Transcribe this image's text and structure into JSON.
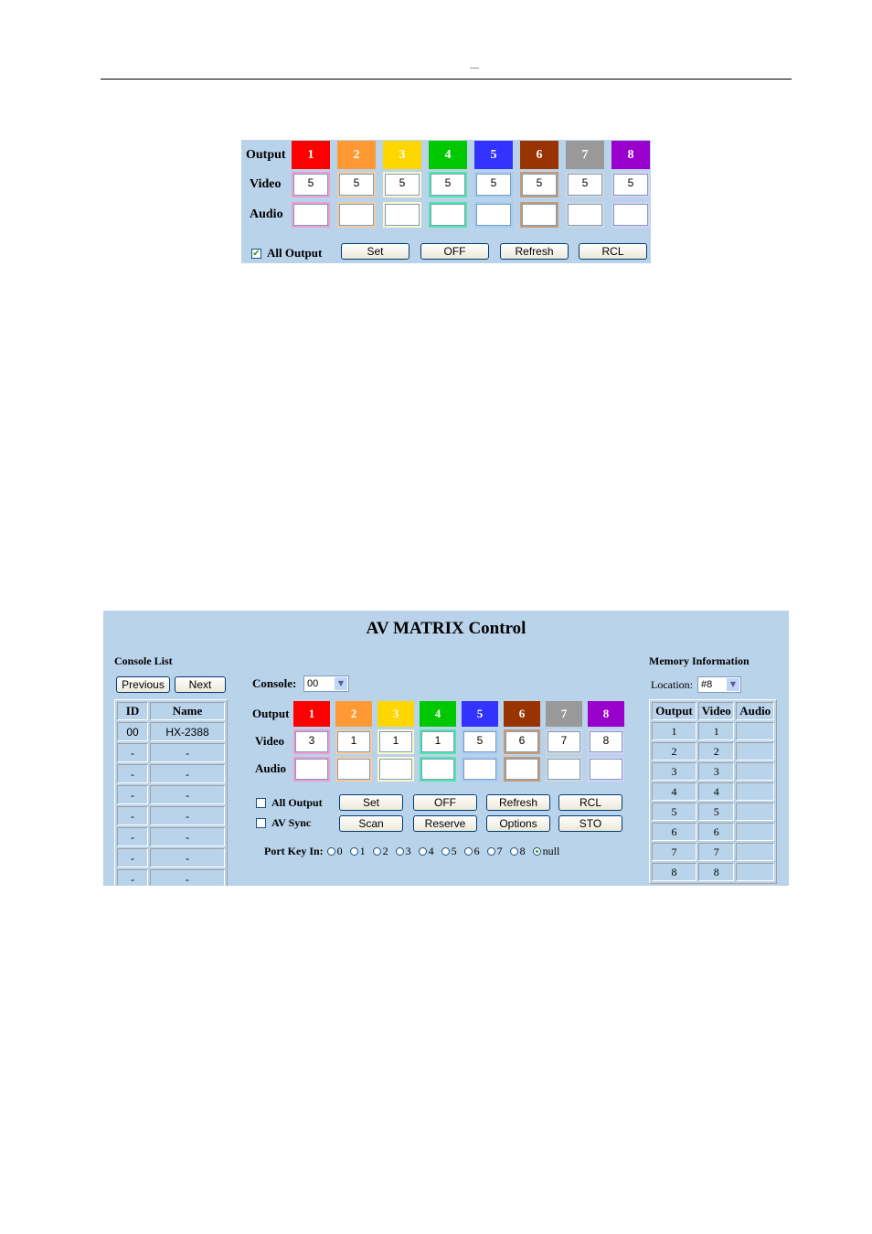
{
  "page": {
    "header_mark": ""
  },
  "panel1": {
    "labels": {
      "output": "Output",
      "video": "Video",
      "audio": "Audio"
    },
    "outputs": [
      {
        "label": "1",
        "color": "#ff0000",
        "border": "#f29bd0",
        "video": "5",
        "audio": ""
      },
      {
        "label": "2",
        "color": "#ff9933",
        "border": "#f8ca9e",
        "video": "5",
        "audio": ""
      },
      {
        "label": "3",
        "color": "#ffd700",
        "border": "#fdf6cc",
        "video": "5",
        "audio": ""
      },
      {
        "label": "4",
        "color": "#00c800",
        "border": "#4fe8a8",
        "video": "5",
        "audio": ""
      },
      {
        "label": "5",
        "color": "#3333ff",
        "border": "#a3cdf4",
        "video": "5",
        "audio": ""
      },
      {
        "label": "6",
        "color": "#993300",
        "border": "#c99a72",
        "video": "5",
        "audio": ""
      },
      {
        "label": "7",
        "color": "#999999",
        "border": "#d0d6dc",
        "video": "5",
        "audio": ""
      },
      {
        "label": "8",
        "color": "#9900cc",
        "border": "#d6cff7",
        "video": "5",
        "audio": ""
      }
    ],
    "all_output": {
      "label": "All Output",
      "checked": true
    },
    "buttons": [
      "Set",
      "OFF",
      "Refresh",
      "RCL"
    ]
  },
  "panel2": {
    "title": "AV MATRIX Control",
    "console_list": {
      "title": "Console List",
      "prev": "Previous",
      "next": "Next",
      "headers": [
        "ID",
        "Name"
      ],
      "rows": [
        [
          "00",
          "HX-2388"
        ],
        [
          "-",
          "-"
        ],
        [
          "-",
          "-"
        ],
        [
          "-",
          "-"
        ],
        [
          "-",
          "-"
        ],
        [
          "-",
          "-"
        ],
        [
          "-",
          "-"
        ],
        [
          "-",
          "-"
        ]
      ]
    },
    "console": {
      "label": "Console:",
      "value": "00"
    },
    "labels": {
      "output": "Output",
      "video": "Video",
      "audio": "Audio"
    },
    "outputs": [
      {
        "label": "1",
        "color": "#ff0000",
        "border": "#f29bd0",
        "video": "3",
        "audio": ""
      },
      {
        "label": "2",
        "color": "#ff9933",
        "border": "#f8ca9e",
        "video": "1",
        "audio": ""
      },
      {
        "label": "3",
        "color": "#ffd700",
        "border": "#fdf6cc",
        "video": "1",
        "audio": ""
      },
      {
        "label": "4",
        "color": "#00c800",
        "border": "#4fe8a8",
        "video": "1",
        "audio": ""
      },
      {
        "label": "5",
        "color": "#3333ff",
        "border": "#a3cdf4",
        "video": "5",
        "audio": ""
      },
      {
        "label": "6",
        "color": "#993300",
        "border": "#c99a72",
        "video": "6",
        "audio": ""
      },
      {
        "label": "7",
        "color": "#999999",
        "border": "#d0d6dc",
        "video": "7",
        "audio": ""
      },
      {
        "label": "8",
        "color": "#9900cc",
        "border": "#d6cff7",
        "video": "8",
        "audio": ""
      }
    ],
    "all_output": {
      "label": "All Output",
      "checked": false
    },
    "av_sync": {
      "label": "AV Sync",
      "checked": false
    },
    "buttons_row1": [
      "Set",
      "OFF",
      "Refresh",
      "RCL"
    ],
    "buttons_row2": [
      "Scan",
      "Reserve",
      "Options",
      "STO"
    ],
    "port_key": {
      "label": "Port Key In:",
      "options": [
        "0",
        "1",
        "2",
        "3",
        "4",
        "5",
        "6",
        "7",
        "8",
        "null"
      ],
      "selected": "null"
    },
    "memory": {
      "title": "Memory Information",
      "location_label": "Location:",
      "location_value": "#8",
      "headers": [
        "Output",
        "Video",
        "Audio"
      ],
      "rows": [
        [
          "1",
          "1",
          ""
        ],
        [
          "2",
          "2",
          ""
        ],
        [
          "3",
          "3",
          ""
        ],
        [
          "4",
          "4",
          ""
        ],
        [
          "5",
          "5",
          ""
        ],
        [
          "6",
          "6",
          ""
        ],
        [
          "7",
          "7",
          ""
        ],
        [
          "8",
          "8",
          ""
        ]
      ]
    }
  }
}
